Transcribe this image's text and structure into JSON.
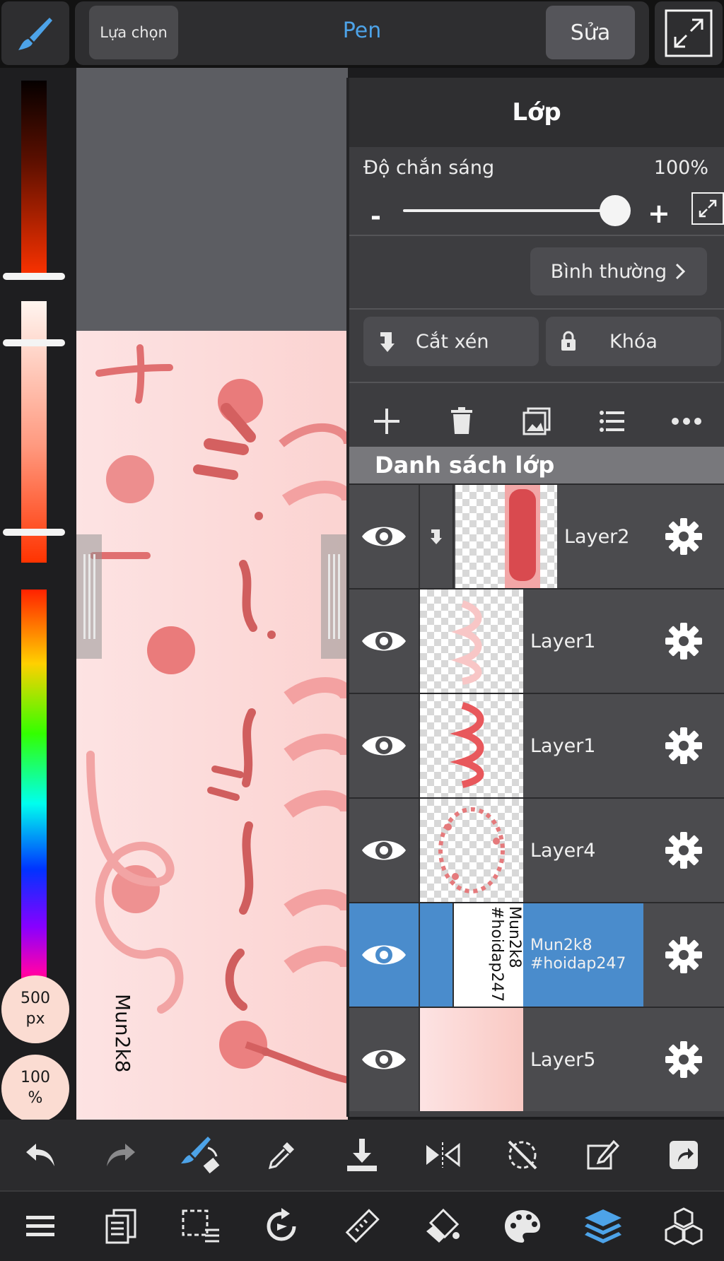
{
  "topbar": {
    "select_label": "Lựa chọn",
    "tool_name": "Pen",
    "edit_label": "Sửa"
  },
  "brush_size": {
    "value": "500",
    "unit": "px"
  },
  "brush_opacity": {
    "value": "100",
    "unit": "%"
  },
  "canvas": {
    "signature_text": "Mun2k8"
  },
  "layer_panel": {
    "title": "Lớp",
    "opacity_label": "Độ chắn sáng",
    "opacity_value": "100%",
    "opacity_level": 1.0,
    "blend_mode": "Bình thường",
    "clip_label": "Cắt xén",
    "lock_label": "Khóa",
    "list_title": "Danh sách lớp",
    "layers": [
      {
        "name": "Layer2",
        "clipped": true,
        "visible": true,
        "active": false
      },
      {
        "name": "Layer1",
        "clipped": false,
        "visible": true,
        "active": false
      },
      {
        "name": "Layer1",
        "clipped": false,
        "visible": true,
        "active": false
      },
      {
        "name": "Layer4",
        "clipped": false,
        "visible": true,
        "active": false
      },
      {
        "name_line1": "Mun2k8",
        "name_line2": "#hoidap247",
        "clipped": false,
        "visible": true,
        "active": true
      },
      {
        "name": "Layer5",
        "clipped": false,
        "visible": true,
        "active": false
      }
    ]
  },
  "colors": {
    "accent_blue": "#4a8ccc",
    "tool_blue": "#4da3e8",
    "panel_bg": "#3d3d40"
  }
}
